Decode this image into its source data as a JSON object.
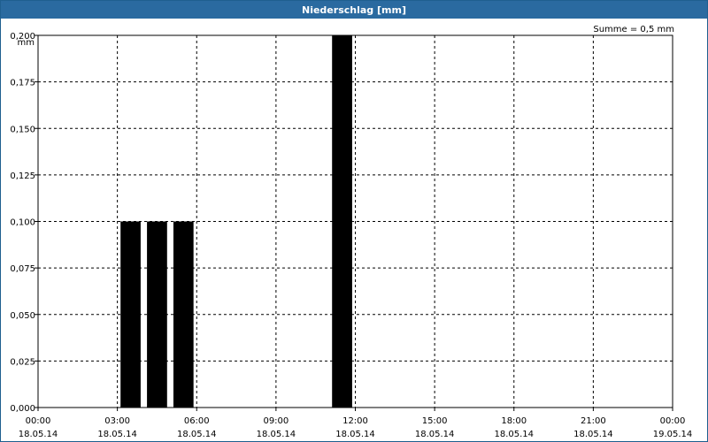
{
  "window": {
    "title": "Niederschlag [mm]"
  },
  "chart_data": {
    "type": "bar",
    "title": "Niederschlag [mm]",
    "ylabel": "mm",
    "annotation": "Summe = 0,5 mm",
    "ylim": [
      0,
      0.2
    ],
    "xlim_hours": [
      0,
      24
    ],
    "grid": true,
    "bar_color": "#000000",
    "y_ticks": [
      "0,000",
      "0,025",
      "0,050",
      "0,075",
      "0,100",
      "0,125",
      "0,150",
      "0,175",
      "0,200"
    ],
    "x_ticks": [
      {
        "time": "00:00",
        "date": "18.05.14"
      },
      {
        "time": "03:00",
        "date": "18.05.14"
      },
      {
        "time": "06:00",
        "date": "18.05.14"
      },
      {
        "time": "09:00",
        "date": "18.05.14"
      },
      {
        "time": "12:00",
        "date": "18.05.14"
      },
      {
        "time": "15:00",
        "date": "18.05.14"
      },
      {
        "time": "18:00",
        "date": "18.05.14"
      },
      {
        "time": "21:00",
        "date": "18.05.14"
      },
      {
        "time": "00:00",
        "date": "19.05.14"
      }
    ],
    "bars": [
      {
        "start": "03:00",
        "end": "04:00",
        "value": 0.1
      },
      {
        "start": "04:00",
        "end": "05:00",
        "value": 0.1
      },
      {
        "start": "05:00",
        "end": "06:00",
        "value": 0.1
      },
      {
        "start": "11:00",
        "end": "12:00",
        "value": 0.2
      }
    ]
  }
}
